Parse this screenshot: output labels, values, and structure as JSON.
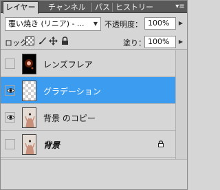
{
  "tabs": [
    {
      "label": "レイヤー",
      "active": true
    },
    {
      "label": "チャンネル",
      "active": false
    },
    {
      "label": "パス",
      "active": false
    },
    {
      "label": "ヒストリー",
      "active": false
    }
  ],
  "panel_menu_icon": "panel-menu-icon",
  "blend_mode": {
    "value": "覆い焼き (リニア) - ..."
  },
  "opacity": {
    "label": "不透明度：",
    "value": "100%"
  },
  "lock": {
    "label": "ロック：",
    "icons": [
      "lock-transparent-icon",
      "lock-brush-icon",
      "lock-move-icon",
      "lock-all-icon"
    ]
  },
  "fill": {
    "label": "塗り：",
    "value": "100%"
  },
  "layers": [
    {
      "name": "レンズフレア",
      "visible": false,
      "selected": false,
      "thumb": "lensflare",
      "italic": false,
      "locked": false
    },
    {
      "name": "グラデーション",
      "visible": true,
      "selected": true,
      "thumb": "transparent",
      "italic": false,
      "locked": false
    },
    {
      "name": "背景 のコピー",
      "visible": true,
      "selected": false,
      "thumb": "photo",
      "italic": false,
      "locked": false
    },
    {
      "name": "背景",
      "visible": false,
      "selected": false,
      "thumb": "photo",
      "italic": true,
      "locked": true
    }
  ],
  "colors": {
    "selected": "#3c9cf0",
    "panel": "#d6d6d6",
    "tabbar": "#595959"
  }
}
